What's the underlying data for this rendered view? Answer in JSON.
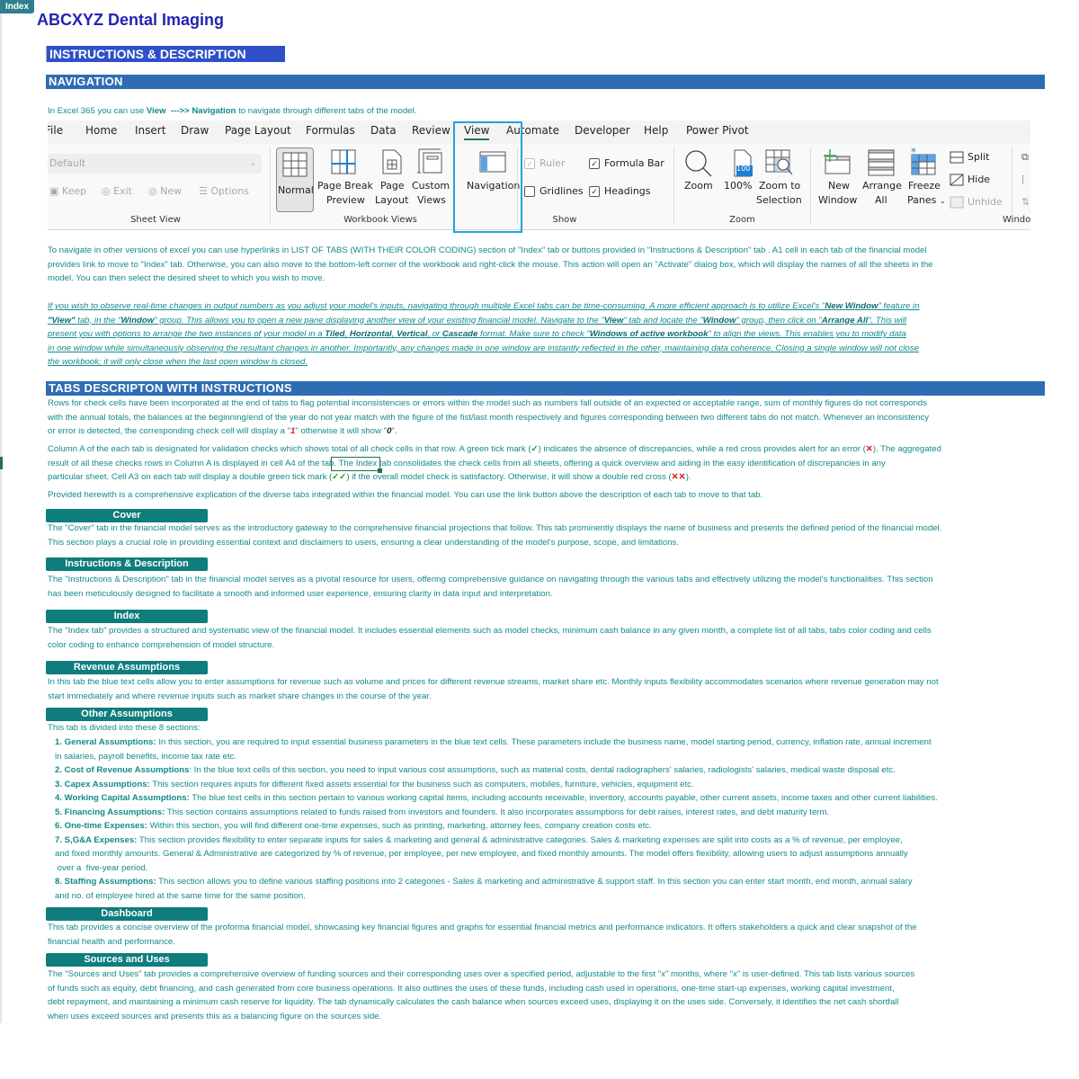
{
  "index_button": "Index",
  "app_title": "ABCXYZ Dental Imaging",
  "page_title": "INSTRUCTIONS & DESCRIPTION",
  "navigation": {
    "heading": "NAVIGATION",
    "intro_pre": "In Excel 365 you can use ",
    "intro_view": "View",
    "intro_arrow": "  --->> ",
    "intro_nav": "Navigation",
    "intro_post": " to navigate through different tabs of the model.",
    "para1_lines": [
      "To navigate in other versions of excel you can use hyperlinks in LIST OF TABS (WITH THEIR COLOR CODING) section of \"Index\" tab or buttons provided in  \"Instructions & Description\" tab . A1 cell in each tab of the financial model",
      "provides link to move to \"Index\" tab. Otherwise, you can also move to the bottom-left corner of the workbook and right-click the mouse. This action will open an \"Activate\" dialog box, which will display the names of all the sheets in the",
      "model. You can then select the desired sheet to which you wish to move."
    ],
    "para2": {
      "l1a": "If you wish to observe real-time changes in output numbers as you adjust your model's inputs, navigating through multiple Excel tabs can be time-consuming. A more efficient approach is to utilize Excel's \"",
      "l1b": "New Window",
      "l1c": "\" feature in",
      "l2a": "\"View\"",
      "l2b": " tab, in the \"",
      "l2c": "Window",
      "l2d": "\" group. This allows you to open a new pane displaying another view of your existing financial model. Navigate to the \"",
      "l2e": "View",
      "l2f": "\" tab and locate the \"",
      "l2g": "Window",
      "l2h": "\" group, then click on \"",
      "l2i": "Arrange All",
      "l2j": "\". This will",
      "l3a": "present you with options to arrange the two instances of your model in a ",
      "l3b": "Tiled",
      "l3c": ", ",
      "l3d": "Horizontal",
      "l3e": ", ",
      "l3f": "Vertical",
      "l3g": ", or ",
      "l3h": "Cascade",
      "l3i": " format. Make sure to check \"",
      "l3j": "Windows of active workbook",
      "l3k": "\" to align the views. This  enables you to modify data",
      "l4": "in one window while simultaneously observing the resultant changes in another. Importantly, any changes made in one window are instantly reflected in the other, maintaining data coherence. Closing a single window will not close",
      "l5": "the workbook; it will only close when the last open window is closed."
    }
  },
  "ribbon": {
    "tabs": [
      "File",
      "Home",
      "Insert",
      "Draw",
      "Page Layout",
      "Formulas",
      "Data",
      "Review",
      "View",
      "Automate",
      "Developer",
      "Help",
      "Power Pivot"
    ],
    "active_tab": "View",
    "sheet_view": {
      "dropdown_value": "Default",
      "keep": "Keep",
      "exit": "Exit",
      "new": "New",
      "options": "Options",
      "group_label": "Sheet View"
    },
    "workbook_views": {
      "normal": "Normal",
      "page_break_1": "Page Break",
      "page_break_2": "Preview",
      "page_layout_1": "Page",
      "page_layout_2": "Layout",
      "custom_1": "Custom",
      "custom_2": "Views",
      "group_label": "Workbook Views"
    },
    "navigation_button": "Navigation",
    "show": {
      "ruler": "Ruler",
      "ruler_checked": true,
      "formula_bar": "Formula Bar",
      "formula_bar_checked": true,
      "gridlines": "Gridlines",
      "gridlines_checked": false,
      "headings": "Headings",
      "headings_checked": true,
      "group_label": "Show"
    },
    "zoom": {
      "zoom": "Zoom",
      "hundred": "100%",
      "hundred_icon_text": "100",
      "zoom_sel_1": "Zoom to",
      "zoom_sel_2": "Selection",
      "group_label": "Zoom"
    },
    "window": {
      "new_1": "New",
      "new_2": "Window",
      "arrange_1": "Arrange",
      "arrange_2": "All",
      "freeze_1": "Freeze",
      "freeze_2": "Panes",
      "split": "Split",
      "hide": "Hide",
      "unhide": "Unhide",
      "group_label": "Windo"
    }
  },
  "tabs_section": {
    "heading": "TABS DESCRIPTON WITH INSTRUCTIONS",
    "p1_l1": "Rows for check cells have been incorporated at the end of tabs to flag potential inconsistencies or errors within the model such as numbers fall outside of an expected or acceptable range, sum of monthly figures do not corresponds",
    "p1_l2": "with the annual totals, the balances at the beginning/end of the year do not year match with the figure of the fist/last month respectively and figures corresponding between two different tabs do not match. Whenever an inconsistency",
    "p1_l3a": "or error is detected, the corresponding check cell will display a \"",
    "p1_one": "1",
    "p1_l3b": "\" otherwise it will show \"",
    "p1_zero": "0",
    "p1_l3c": "\".",
    "p2_l1a": "Column A of the each tab is designated for validation checks which shows total of all check cells in that row. A green tick mark (",
    "tick": "✓",
    "p2_l1b": ") indicates the absence of discrepancies, while a red cross provides alert for an error (",
    "cross": "✕",
    "p2_l1c": "). The aggregated",
    "p2_l2": "result of all these checks rows in Column A is displayed in cell A4 of the tab. The Index tab consolidates the check cells from all sheets, offering a quick overview and aiding in the easy identification of discrepancies in any",
    "p2_l3a": "particular sheet. Cell A3 on each tab will display a double green tick mark (",
    "double_tick": "✓✓",
    "p2_l3b": ") if the overall model check is satisfactory. Otherwise, it will show a double red cross (",
    "double_cross": "✕✕",
    "p2_l3c": ").",
    "p3": "Provided herewith is a comprehensive explication of the diverse tabs integrated within the financial model. You can use the link button above the description of each tab to move to that tab."
  },
  "tab_descriptions": [
    {
      "label": "Cover",
      "lines": [
        "The \"Cover\" tab in the financial model serves as the introductory gateway to the comprehensive financial projections that follow. This tab prominently displays the name of business and presents the defined period of the financial model.",
        "This section plays  a crucial role in providing essential context and disclaimers to users, ensuring a clear understanding of the model's purpose, scope, and limitations."
      ]
    },
    {
      "label": "Instructions & Description",
      "lines": [
        "The \"Instructions & Description\" tab in the financial model serves as a pivotal resource for users, offering comprehensive guidance on navigating through the various tabs and effectively utilizing the model's functionalities. This section",
        "has been meticulously designed to facilitate a smooth and informed user experience, ensuring clarity in data input and interpretation."
      ]
    },
    {
      "label": "Index",
      "lines": [
        "The \"Index tab\" provides a structured and systematic view of the financial model. It includes essential elements such as model checks, minimum cash balance in any given month, a complete list of all tabs, tabs color coding and cells",
        "color coding to enhance comprehension of model structure."
      ]
    },
    {
      "label": "Revenue Assumptions",
      "lines": [
        "In this tab the blue text cells allow you to enter assumptions for revenue such as volume and prices for different revenue streams, market share etc. Monthly inputs flexibility accommodates scenarios where revenue generation may not",
        "start immediately and where revenue inputs such as market share changes in the course of the year."
      ]
    },
    {
      "label": "Other Assumptions",
      "intro": "This tab is divided into these 8 sections:",
      "items": [
        {
          "title": "1. General Assumptions:",
          "lines": [
            " In this section, you are required to input essential business parameters in the blue text cells. These parameters include the business name, model starting period, currency, inflation rate, annual increment",
            "in salaries, payroll benefits, income tax rate etc."
          ]
        },
        {
          "title": "2. Cost of Revenue Assumptions",
          "lines": [
            ": In the blue text cells of this section, you need to input various cost assumptions, such as material costs, dental radiographers' salaries, radiologists' salaries, medical waste disposal etc."
          ]
        },
        {
          "title": "3. Capex Assumptions:",
          "lines": [
            " This section requires inputs for different fixed assets essential for the business such as computers, mobiles, furniture, vehicles, equipment etc."
          ]
        },
        {
          "title": "4. Working Capital Assumptions:",
          "lines": [
            " The blue text cells in this section pertain to various working capital items, including accounts receivable, inventory, accounts payable, other current assets, income taxes and other current liabilities."
          ]
        },
        {
          "title": "5. Financing Assumptions:",
          "lines": [
            " This section contains assumptions related to funds raised from investors and founders. It also incorporates assumptions for debt raises, interest rates, and debt maturity term."
          ]
        },
        {
          "title": "6. One-time Expenses:",
          "lines": [
            " Within this section, you will find different one-time expenses, such as printing, marketing, attorney fees, company creation costs etc."
          ]
        },
        {
          "title": "7. S,G&A Expenses:",
          "lines": [
            " This section provides flexibility to enter separate inputs for sales & marketing and general & administrative categories. Sales & marketing expenses are split into costs as a % of revenue, per employee,",
            "and fixed monthly amounts. General & Administrative are categorized by % of revenue, per employee, per new employee, and fixed monthly amounts. The model offers flexibility, allowing users to adjust assumptions annually",
            " over a  five-year period."
          ]
        },
        {
          "title": "8. Staffing Assumptions:",
          "lines": [
            " This section allows you to define various staffing positions into 2 categories - Sales & marketing and administrative & support staff. In this section you can enter start month, end month, annual salary",
            "and no. of employee hired at  the same time for the same position."
          ]
        }
      ]
    },
    {
      "label": "Dashboard",
      "lines": [
        "This tab provides a concise overview of the proforma financial model, showcasing key financial figures and graphs for essential financial metrics and performance indicators. It offers stakeholders a quick and clear snapshot of the",
        "financial health and performance."
      ]
    },
    {
      "label": "Sources and Uses",
      "lines": [
        "The \"Sources and Uses\" tab provides a comprehensive overview of funding sources and their corresponding uses over a specified period, adjustable to the first \"x\" months, where \"x\" is user-defined. This tab lists various sources",
        "of funds such as equity, debt financing, and cash generated from core business operations. It also outlines the uses of these funds, including cash used in operations, one-time start-up expenses, working capital investment,",
        "debt repayment, and maintaining  a minimum cash reserve for liquidity. The tab dynamically calculates the cash balance when sources exceed uses, displaying it on the uses side. Conversely, it identifies the net cash shortfall",
        "when uses exceed sources and presents this as a balancing figure on the sources side."
      ]
    }
  ],
  "colors": {
    "text_teal": "#138a8a",
    "pill_teal": "#0f7d7d",
    "title_blue": "#2424b0",
    "header_blue": "#2e6db4",
    "page_title_blue": "#2e50c8",
    "highlight_blue": "#1fa3e0",
    "excel_green": "#217346",
    "error_red": "#e01818",
    "tick_green": "#1aa01a"
  }
}
